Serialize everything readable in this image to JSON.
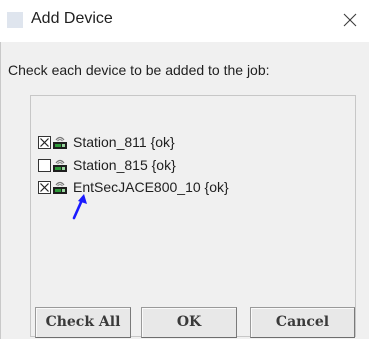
{
  "window": {
    "title": "Add Device",
    "icons": {
      "app": "app-icon",
      "close": "close-icon"
    }
  },
  "instruction": "Check each device to be added to the job:",
  "devices": [
    {
      "label": "Station_811 {ok}",
      "checked": true,
      "icon": "station-status-icon"
    },
    {
      "label": "Station_815 {ok}",
      "checked": false,
      "icon": "station-status-icon"
    },
    {
      "label": "EntSecJACE800_10 {ok}",
      "checked": true,
      "icon": "station-status-icon"
    }
  ],
  "buttons": {
    "check_all": "Check All",
    "ok": "OK",
    "cancel": "Cancel"
  },
  "annotation": {
    "icon": "arrow-icon",
    "color": "#1a1aff"
  },
  "colors": {
    "background": "#f0f0f0",
    "title_bar": "#ffffff",
    "button_face": "#e8e8e8",
    "station_green": "#2e9a3a"
  }
}
